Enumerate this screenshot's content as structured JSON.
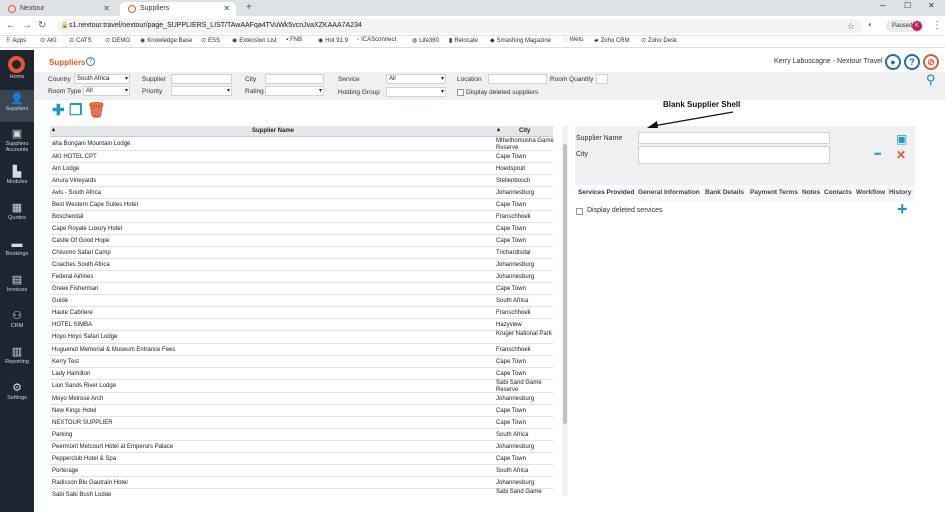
{
  "browser": {
    "tabs": [
      {
        "title": "Nextour"
      },
      {
        "title": "Suppliers"
      }
    ],
    "url": "s1.nextour.travel/nextour/page_SUPPLIERS_LIST/TAwAAFqa4TVuWk5vcnJvaXZKAAA7A234",
    "profile_label": "Paused",
    "profile_initial": "K"
  },
  "bookmarks": [
    "Apps",
    "AKI",
    "CATS",
    "DEMO",
    "Knowledge Base",
    "ESS",
    "Extension List",
    "FNB",
    "Hot 91.9",
    "ICASconnect",
    "Life360",
    "Relocate",
    "Smashing Magazine",
    "Wetu",
    "Zoho CRM",
    "Zoho Desk"
  ],
  "sidebar": [
    {
      "label": "Home"
    },
    {
      "label": "Suppliers"
    },
    {
      "label": "Suppliers Accounts"
    },
    {
      "label": "Modules"
    },
    {
      "label": "Quotes"
    },
    {
      "label": "Bookings"
    },
    {
      "label": "Invoices"
    },
    {
      "label": "CRM"
    },
    {
      "label": "Reporting"
    },
    {
      "label": "Settings"
    }
  ],
  "header": {
    "title": "Suppliers",
    "user": "Kerry Labuscagne - Nextour Travel"
  },
  "filters": {
    "country_label": "Country",
    "country_value": "South Africa",
    "supplier_label": "Supplier",
    "city_label": "City",
    "service_label": "Service",
    "service_value": "All",
    "location_label": "Location",
    "room_qty_label": "Room Quantity",
    "room_type_label": "Room Type",
    "room_type_value": "All",
    "priority_label": "Priority",
    "rating_label": "Rating",
    "holding_label": "Holding Group",
    "deleted_label": "Display deleted suppliers"
  },
  "grid": {
    "col_name": "Supplier Name",
    "col_city": "City",
    "rows": [
      {
        "name": "aha Bongani Mountain Lodge",
        "city": "Mthethomusha Game Reserve"
      },
      {
        "name": "AKI HOTEL CPT",
        "city": "Cape Town"
      },
      {
        "name": "Am Lodge",
        "city": "Hoedspruit"
      },
      {
        "name": "Anura Vineyards",
        "city": "Stellenbosch"
      },
      {
        "name": "Avis - South Africa",
        "city": "Johannesburg"
      },
      {
        "name": "Best Western Cape Suites Hotel",
        "city": "Cape Town"
      },
      {
        "name": "Boschendal",
        "city": "Franschhoek"
      },
      {
        "name": "Cape Royale Luxury Hotel",
        "city": "Cape Town"
      },
      {
        "name": "Castle Of Good Hope",
        "city": "Cape Town"
      },
      {
        "name": "Chisomo Safari Camp",
        "city": "Trichardtsdal"
      },
      {
        "name": "Coaches South Africa",
        "city": "Johannesburg"
      },
      {
        "name": "Federal Airlines",
        "city": "Johannesburg"
      },
      {
        "name": "Greek Fisherman",
        "city": "Cape Town"
      },
      {
        "name": "Guide",
        "city": "South Africa"
      },
      {
        "name": "Haute Cabriere",
        "city": "Franschhoek"
      },
      {
        "name": "HOTEL SIMBA",
        "city": "Hazyview"
      },
      {
        "name": "Hoyo Hoyo Safari Lodge",
        "city": "Kruger National Park"
      },
      {
        "name": "Huguenot Memorial & Museum Entrance Fees",
        "city": "Franschhoek"
      },
      {
        "name": "Kerry Test",
        "city": "Cape Town"
      },
      {
        "name": "Lady Hamilton",
        "city": "Cape Town"
      },
      {
        "name": "Lion Sands River Lodge",
        "city": "Sabi Sand Game Reserve"
      },
      {
        "name": "Moyo Melrose Arch",
        "city": "Johannesburg"
      },
      {
        "name": "New Kings Hotel",
        "city": "Cape Town"
      },
      {
        "name": "NEXTOUR SUPPLIER",
        "city": "Cape Town"
      },
      {
        "name": "Parking",
        "city": "South Africa"
      },
      {
        "name": "Peermont Metcourt Hotel at Emperors Palace",
        "city": "Johannesburg"
      },
      {
        "name": "Pepperclub Hotel & Spa",
        "city": "Cape Town"
      },
      {
        "name": "Porterage",
        "city": "South Africa"
      },
      {
        "name": "Radisson Blu Gautrain Hotel",
        "city": "Johannesburg"
      },
      {
        "name": "Sabi Sabi Bush Lodge",
        "city": "Sabi Sand Game Reserve"
      }
    ]
  },
  "form": {
    "supplier_name_label": "Supplier Name",
    "city_label": "City",
    "tabs": [
      "Services Provided",
      "General Information",
      "Bank Details",
      "Payment Terms",
      "Notes",
      "Contacts",
      "Workflow",
      "History"
    ],
    "deleted_services_label": "Display deleted services"
  },
  "annotation": "Blank Supplier Shell",
  "colors": {
    "accent": "#e8572b",
    "teal": "#1a9bc2",
    "sidebar": "#1c2530"
  }
}
